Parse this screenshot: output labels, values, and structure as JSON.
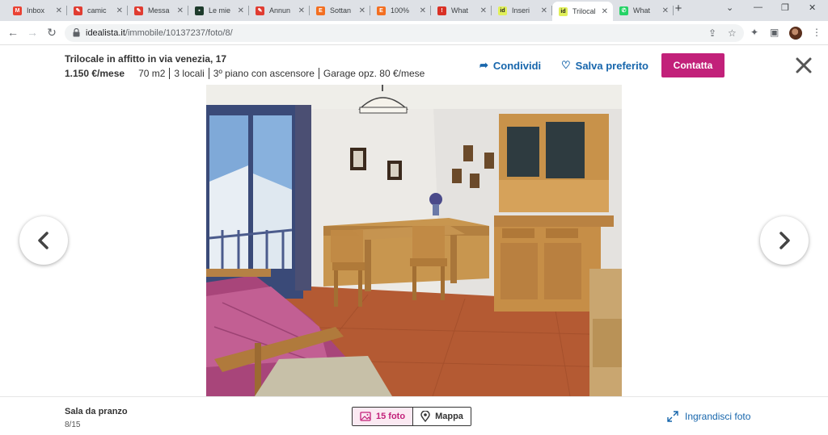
{
  "browser": {
    "tabs": [
      {
        "title": "Inbox",
        "icon": "gmail-icon",
        "color": "#ea4335",
        "glyph": "M"
      },
      {
        "title": "camic",
        "icon": "red-circle-icon",
        "color": "#e03c31",
        "glyph": "✎"
      },
      {
        "title": "Messa",
        "icon": "red-circle-icon",
        "color": "#e03c31",
        "glyph": "✎"
      },
      {
        "title": "Le mie",
        "icon": "dark-green-icon",
        "color": "#1e3b2c",
        "glyph": "▪"
      },
      {
        "title": "Annun",
        "icon": "red-circle-icon",
        "color": "#e03c31",
        "glyph": "✎"
      },
      {
        "title": "Sottan",
        "icon": "e-orange-icon",
        "color": "#f36f21",
        "glyph": "E"
      },
      {
        "title": "100%",
        "icon": "e-orange-icon",
        "color": "#f36f21",
        "glyph": "E"
      },
      {
        "title": "What",
        "icon": "red-alert-icon",
        "color": "#d93025",
        "glyph": "!"
      },
      {
        "title": "Inseri",
        "icon": "idealista-icon",
        "color": "#e1f05a",
        "glyph": "id"
      },
      {
        "title": "Trilocal",
        "icon": "idealista-icon",
        "color": "#e1f05a",
        "glyph": "id",
        "active": true
      },
      {
        "title": "What",
        "icon": "whatsapp-icon",
        "color": "#25d366",
        "glyph": "✆"
      }
    ],
    "url_host": "idealista.it",
    "url_path": "/immobile/10137237/foto/8/"
  },
  "listing": {
    "title": "Trilocale in affitto in via venezia, 17",
    "price": "1.150 €/mese",
    "features": [
      "70 m2",
      "3 locali",
      "3º piano con ascensore",
      "Garage opz. 80 €/mese"
    ],
    "share_label": "Condividi",
    "save_label": "Salva preferito",
    "contact_label": "Contatta"
  },
  "gallery": {
    "caption": "Sala da pranzo",
    "counter": "8/15",
    "photos_label": "15 foto",
    "map_label": "Mappa",
    "enlarge_label": "Ingrandisci foto"
  },
  "colors": {
    "accent": "#c2217a",
    "link": "#1766ac"
  }
}
